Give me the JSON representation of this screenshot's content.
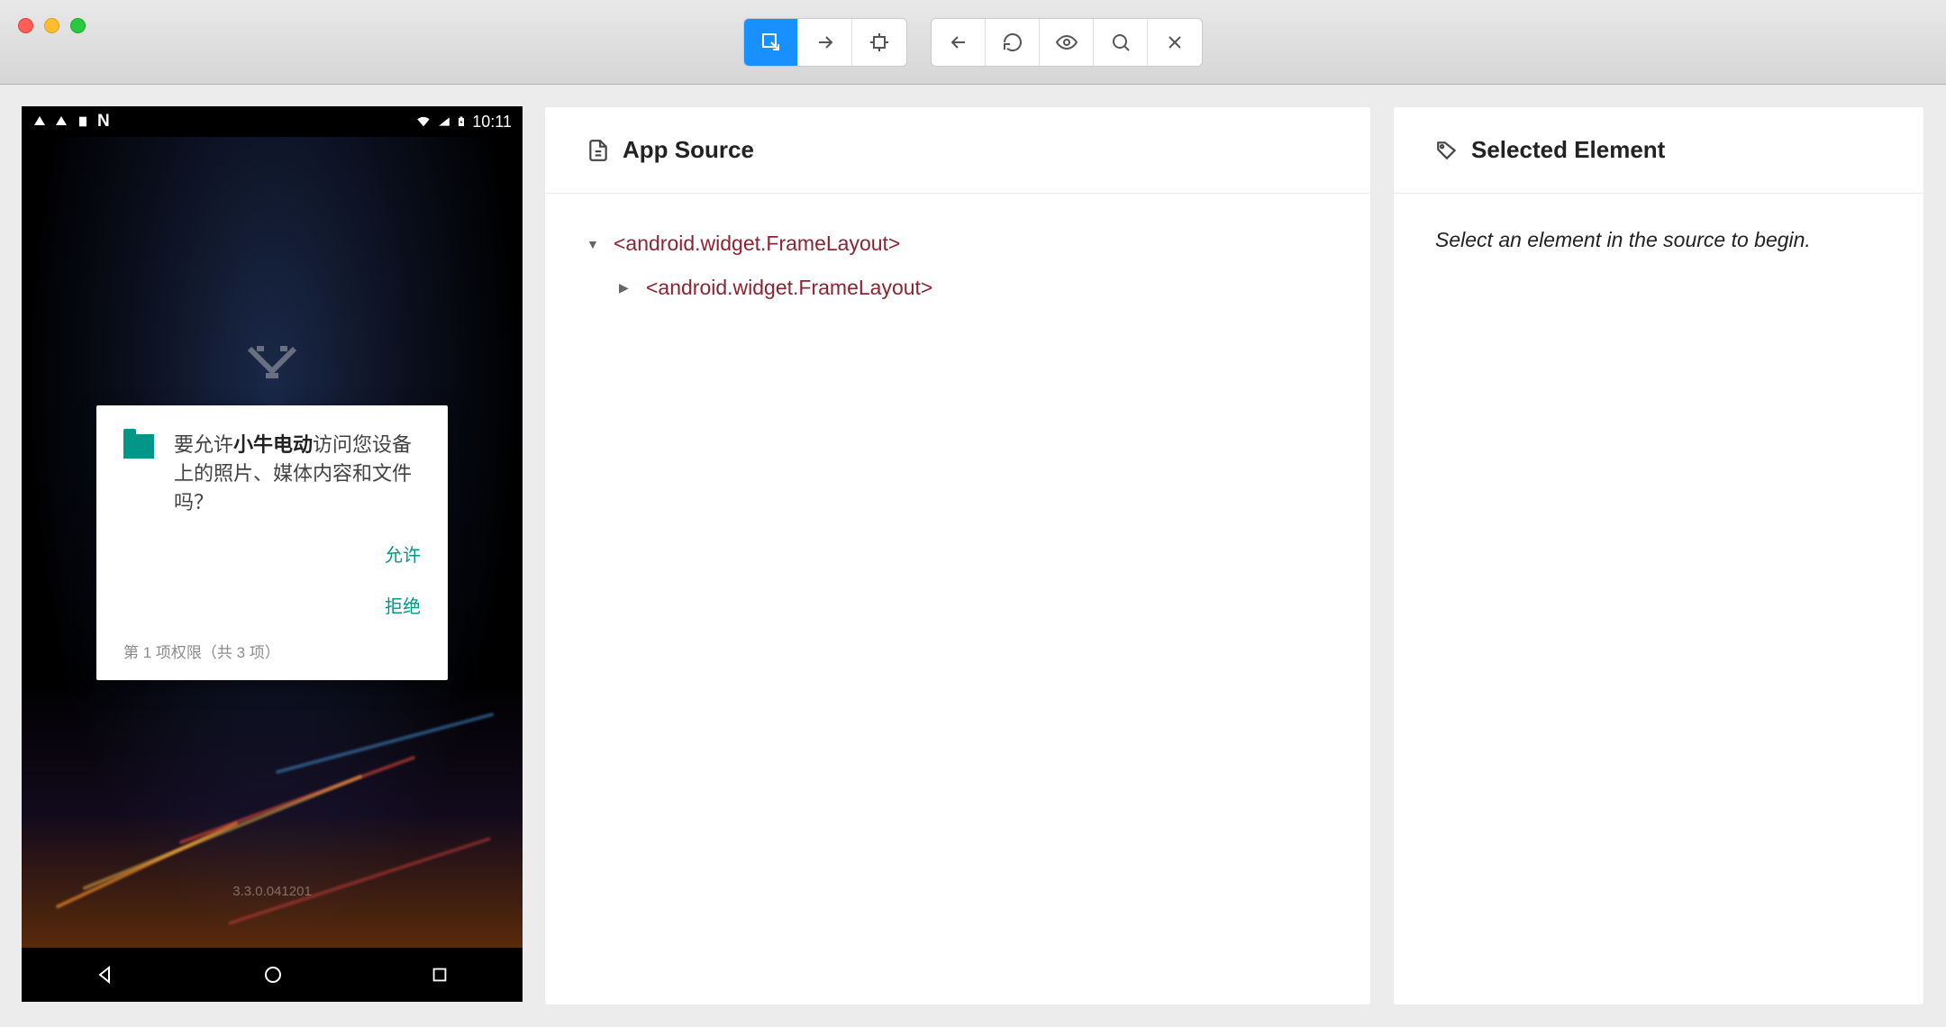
{
  "device": {
    "status_time": "10:11",
    "version": "3.3.0.041201",
    "dialog": {
      "text_prefix": "要允许",
      "app_name": "小牛电动",
      "text_suffix": "访问您设备上的照片、媒体内容和文件吗？",
      "allow": "允许",
      "deny": "拒绝",
      "footer": "第 1 项权限（共 3 项）"
    }
  },
  "source": {
    "title": "App Source",
    "tree": {
      "root": "<android.widget.FrameLayout>",
      "child": "<android.widget.FrameLayout>"
    }
  },
  "selected": {
    "title": "Selected Element",
    "placeholder": "Select an element in the source to begin."
  }
}
